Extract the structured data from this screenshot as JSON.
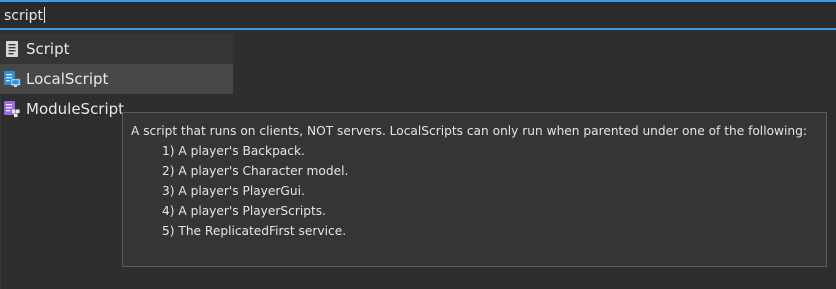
{
  "search": {
    "value": "script"
  },
  "results": [
    {
      "label": "Script",
      "icon": "script-icon"
    },
    {
      "label": "LocalScript",
      "icon": "local-script-icon"
    },
    {
      "label": "ModuleScript",
      "icon": "module-script-icon"
    }
  ],
  "tooltip": {
    "description": "A script that runs on clients, NOT servers.  LocalScripts can only run when parented under one of the following:",
    "items": [
      "1) A player's Backpack.",
      "2) A player's Character model.",
      "3) A player's PlayerGui.",
      "4) A player's PlayerScripts.",
      "5) The ReplicatedFirst service."
    ]
  },
  "colors": {
    "focus_border": "#3a9be6",
    "background": "#2e2e2e",
    "hover_row": "#484848",
    "module_icon": "#9a6be0",
    "local_icon": "#2f8fd8"
  }
}
